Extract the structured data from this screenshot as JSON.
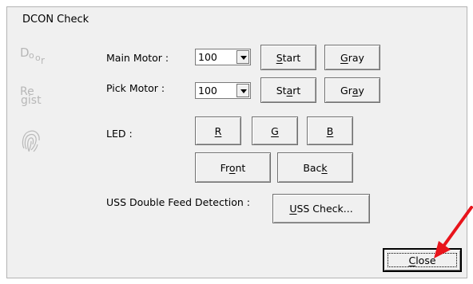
{
  "title": "DCON Check",
  "side_icons": {
    "door": {
      "d": "D",
      "o1": "o",
      "o2": "o",
      "r": "r"
    },
    "regist": {
      "top": "Re",
      "bottom": "gist"
    },
    "fingerprint": "fingerprint-icon"
  },
  "main_motor": {
    "label": "Main Motor :",
    "value": "100",
    "start_pre": "",
    "start_u": "S",
    "start_post": "tart",
    "gray_pre": "",
    "gray_u": "G",
    "gray_post": "ray"
  },
  "pick_motor": {
    "label": "Pick Motor :",
    "value": "100",
    "start_pre": "St",
    "start_u": "a",
    "start_post": "rt",
    "gray_pre": "Gr",
    "gray_u": "a",
    "gray_post": "y"
  },
  "led": {
    "label": "LED :",
    "r": "R",
    "g": "G",
    "b": "B",
    "front_pre": "Fr",
    "front_u": "o",
    "front_post": "nt",
    "back_pre": "Bac",
    "back_u": "k",
    "back_post": ""
  },
  "uss": {
    "label": "USS Double Feed Detection :",
    "button_u": "U",
    "button_post": "SS Check..."
  },
  "close": {
    "u": "C",
    "post": "lose"
  },
  "annotation": {
    "arrow_color": "#e8141b"
  }
}
